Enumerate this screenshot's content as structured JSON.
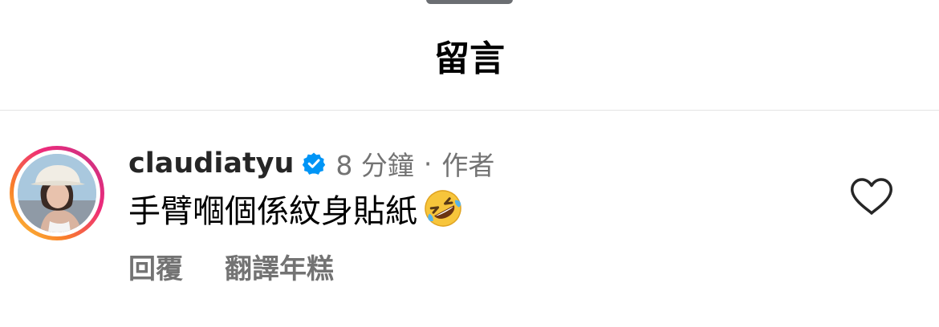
{
  "header": {
    "title": "留言"
  },
  "comment": {
    "username": "claudiatyu",
    "verified": true,
    "time": "8 分鐘",
    "separator": "·",
    "author_badge": "作者",
    "text": "手臂嗰個係紋身貼紙",
    "emoji": "rolling-on-the-floor-laughing-emoji",
    "actions": {
      "reply": "回覆",
      "translate": "翻譯年糕"
    },
    "like_icon": "heart-outline-icon"
  },
  "colors": {
    "verified_blue": "#0095f6",
    "secondary_text": "#737373",
    "primary_text": "#262626",
    "story_ring": [
      "#fccc3a",
      "#f97f2a",
      "#ee2a7b",
      "#c13584"
    ]
  }
}
